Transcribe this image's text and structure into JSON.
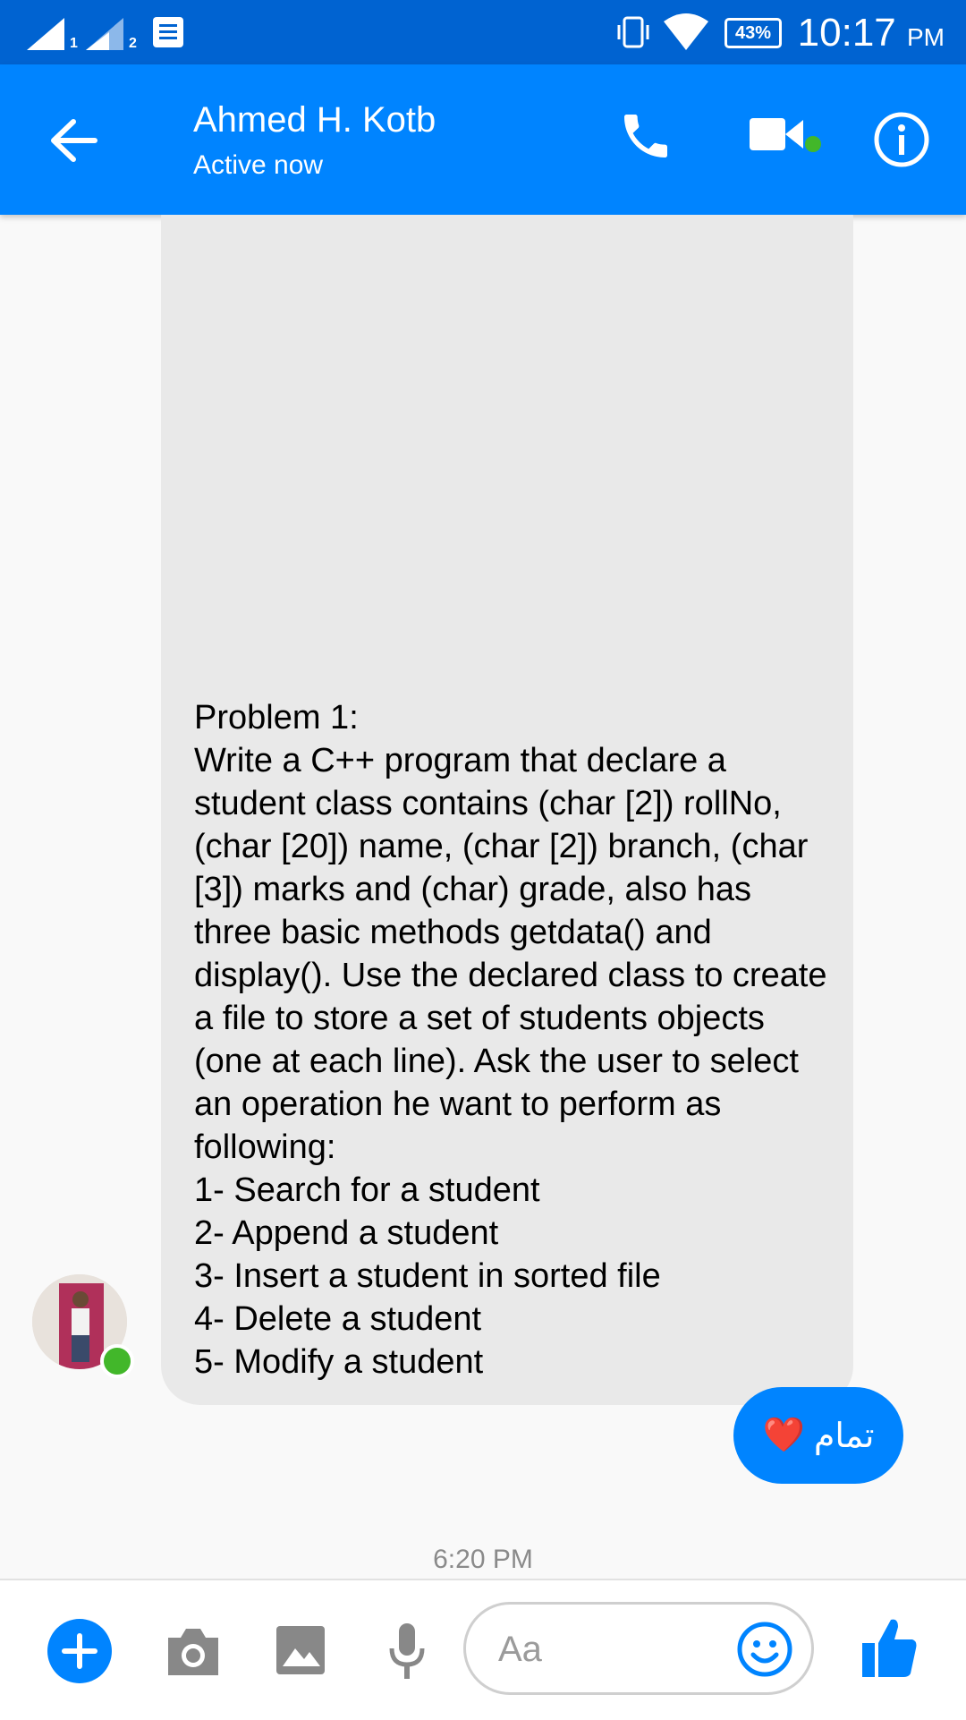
{
  "status_bar": {
    "time": "10:17",
    "ampm": "PM",
    "battery": "43%",
    "sim1": "1",
    "sim2": "2"
  },
  "header": {
    "name": "Ahmed H. Kotb",
    "status": "Active now"
  },
  "messages": {
    "incoming_text": "Problem 1:\nWrite a C++ program that declare a student class contains (char [2]) rollNo, (char [20]) name, (char [2]) branch, (char [3]) marks and (char) grade, also has three basic methods getdata() and display(). Use the declared class to create a file to store a set of students objects (one at each line). Ask the user to select an operation he want to perform as following:\n1- Search for a student\n2- Append a student\n3- Insert a student in sorted file\n4- Delete a student\n5- Modify a student",
    "outgoing_text": "تمام",
    "outgoing_emoji": "❤️",
    "timestamp": "6:20 PM"
  },
  "composer": {
    "placeholder": "Aa"
  },
  "colors": {
    "brand": "#0084ff",
    "status_bar": "#0063d1",
    "presence": "#42b72a"
  },
  "icons": [
    "back-arrow-icon",
    "phone-icon",
    "video-camera-icon",
    "info-icon",
    "plus-icon",
    "camera-icon",
    "image-icon",
    "microphone-icon",
    "emoji-icon",
    "thumbs-up-icon"
  ]
}
